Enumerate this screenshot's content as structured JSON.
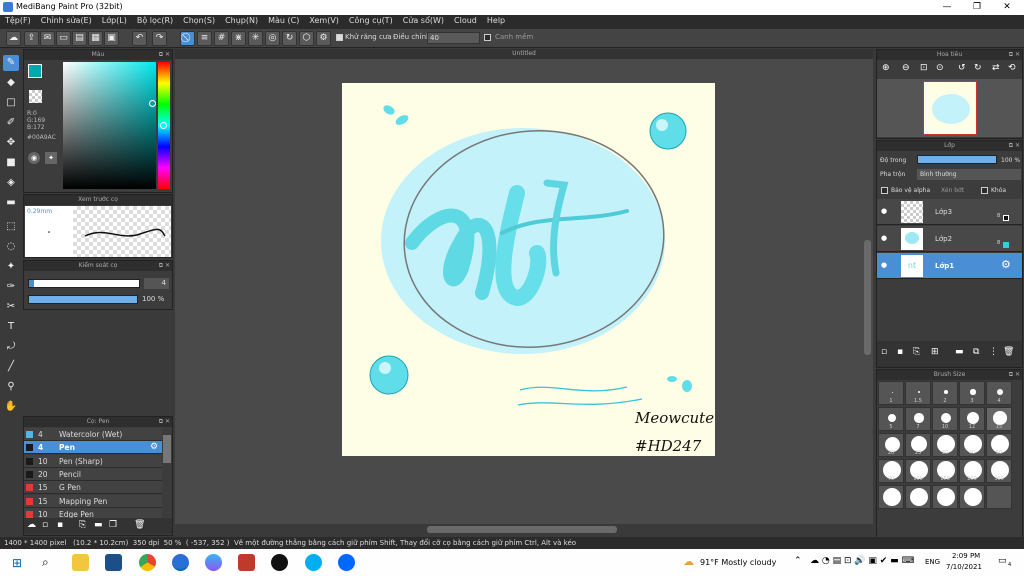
{
  "window": {
    "title": "MediBang Paint Pro (32bit)"
  },
  "menu": [
    "Tệp(F)",
    "Chỉnh sửa(E)",
    "Lớp(L)",
    "Bộ lọc(R)",
    "Chọn(S)",
    "Chụp(N)",
    "Màu (C)",
    "Xem(V)",
    "Công cụ(T)",
    "Cửa sổ(W)",
    "Cloud",
    "Help"
  ],
  "toolbar": {
    "antialias_label": "Khử răng cưa",
    "adjust_label": "Điều chỉnh",
    "adjust_value": "40",
    "snap_label": "Canh mềm"
  },
  "color_panel": {
    "title": "Màu",
    "r": "R:0",
    "g": "G:169",
    "b": "B:172",
    "hex": "#00A9AC"
  },
  "preview_panel": {
    "title": "Xem trước cọ",
    "size": "0.29mm"
  },
  "control_panel": {
    "title": "Kiểm soát cọ",
    "size_value": "4",
    "opacity_value": "100 %"
  },
  "brush_panel": {
    "title": "Cọ: Pen",
    "items": [
      {
        "size": "4",
        "name": "Watercolor (Wet)",
        "color": "#4fb8e8"
      },
      {
        "size": "4",
        "name": "Pen",
        "color": "#1a1a1a"
      },
      {
        "size": "10",
        "name": "Pen (Sharp)",
        "color": "#1a1a1a"
      },
      {
        "size": "20",
        "name": "Pencil",
        "color": "#1a1a1a"
      },
      {
        "size": "15",
        "name": "G Pen",
        "color": "#e53935"
      },
      {
        "size": "15",
        "name": "Mapping Pen",
        "color": "#e53935"
      },
      {
        "size": "10",
        "name": "Edge Pen",
        "color": "#e53935"
      }
    ]
  },
  "canvas": {
    "title": "Untitled",
    "sign1": "Meowcute",
    "sign2": "#HD247"
  },
  "navigator": {
    "title": "Hoa tiêu"
  },
  "layers": {
    "title": "Lớp",
    "opacity_label": "Độ trong",
    "opacity_value": "100 %",
    "blend_label": "Pha trộn",
    "blend_value": "Bình thường",
    "protect_alpha": "Bảo vệ alpha",
    "clipping": "Xén bớt",
    "lock": "Khóa",
    "items": [
      {
        "name": "Lớp3",
        "mark": "8"
      },
      {
        "name": "Lớp2",
        "mark": "8"
      },
      {
        "name": "Lớp1",
        "mark": ""
      }
    ]
  },
  "brush_size": {
    "title": "Brush Size",
    "labels": [
      "1",
      "1.5",
      "2",
      "3",
      "4",
      "5",
      "7",
      "10",
      "12",
      "15",
      "20",
      "25",
      "30",
      "40",
      "50",
      "70",
      "100",
      "150",
      "200",
      "300"
    ]
  },
  "status": {
    "dims": "1400 * 1400 pixel",
    "cm": "(10.2 * 10.2cm)",
    "dpi": "350 dpi",
    "zoom": "50 %",
    "coords": "( -537, 352 )",
    "hint": "Vẽ một đường thẳng bằng cách giữ phím Shift, Thay đổi cỡ cọ bằng cách giữ phím Ctrl, Alt và kéo"
  },
  "taskbar": {
    "weather": "91°F  Mostly cloudy",
    "lang": "ENG",
    "time": "2:09 PM",
    "date": "7/10/2021",
    "notif": "4"
  },
  "colors": {
    "accent": "#4a8fd6",
    "cyan": "#00a9ac",
    "panel": "#3c3c3c"
  }
}
